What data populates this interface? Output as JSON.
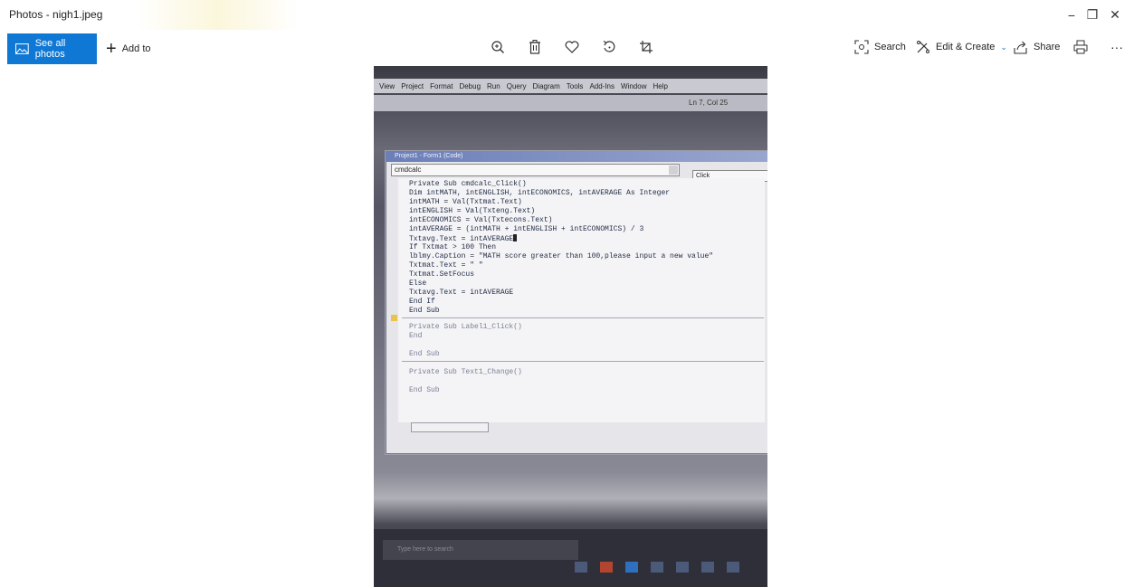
{
  "window": {
    "title": "Photos - nigh1.jpeg",
    "controls": {
      "minimize": "−",
      "maximize": "❐",
      "close": "✕"
    }
  },
  "toolbar": {
    "see_all_photos": "See all photos",
    "add_to": "Add to",
    "center_icons": [
      "zoom-in-icon",
      "delete-icon",
      "favorite-icon",
      "rotate-icon",
      "crop-icon"
    ],
    "search": "Search",
    "edit_create": "Edit & Create",
    "share": "Share",
    "more": "···",
    "accent": "#0f78d4"
  },
  "photo": {
    "vb_menu": [
      "View",
      "Project",
      "Format",
      "Debug",
      "Run",
      "Query",
      "Diagram",
      "Tools",
      "Add-Ins",
      "Window",
      "Help"
    ],
    "status": "Ln 7, Col 25",
    "code_window_title": "Project1 - Form1 (Code)",
    "object_combo": "cmdcalc",
    "proc_combo": "Click",
    "code_lines": [
      "Private Sub cmdcalc_Click()",
      "Dim intMATH, intENGLISH, intECONOMICS, intAVERAGE As Integer",
      "intMATH = Val(Txtmat.Text)",
      "intENGLISH = Val(Txteng.Text)",
      "intECONOMICS = Val(Txtecons.Text)",
      "intAVERAGE = (intMATH + intENGLISH + intECONOMICS) / 3",
      "Txtavg.Text = intAVERAGE",
      "If Txtmat > 100 Then",
      "lblmy.Caption = \"MATH score greater than 100,please input a new value\"",
      "Txtmat.Text = \" \"",
      "Txtmat.SetFocus",
      "Else",
      "Txtavg.Text = intAVERAGE",
      "End If",
      "End Sub"
    ],
    "code_lines_lower": [
      "Private Sub Label1_Click()",
      "End",
      "End Sub",
      "Private Sub Text1_Change()",
      "End Sub"
    ],
    "taskbar_search": "Type here to search"
  }
}
